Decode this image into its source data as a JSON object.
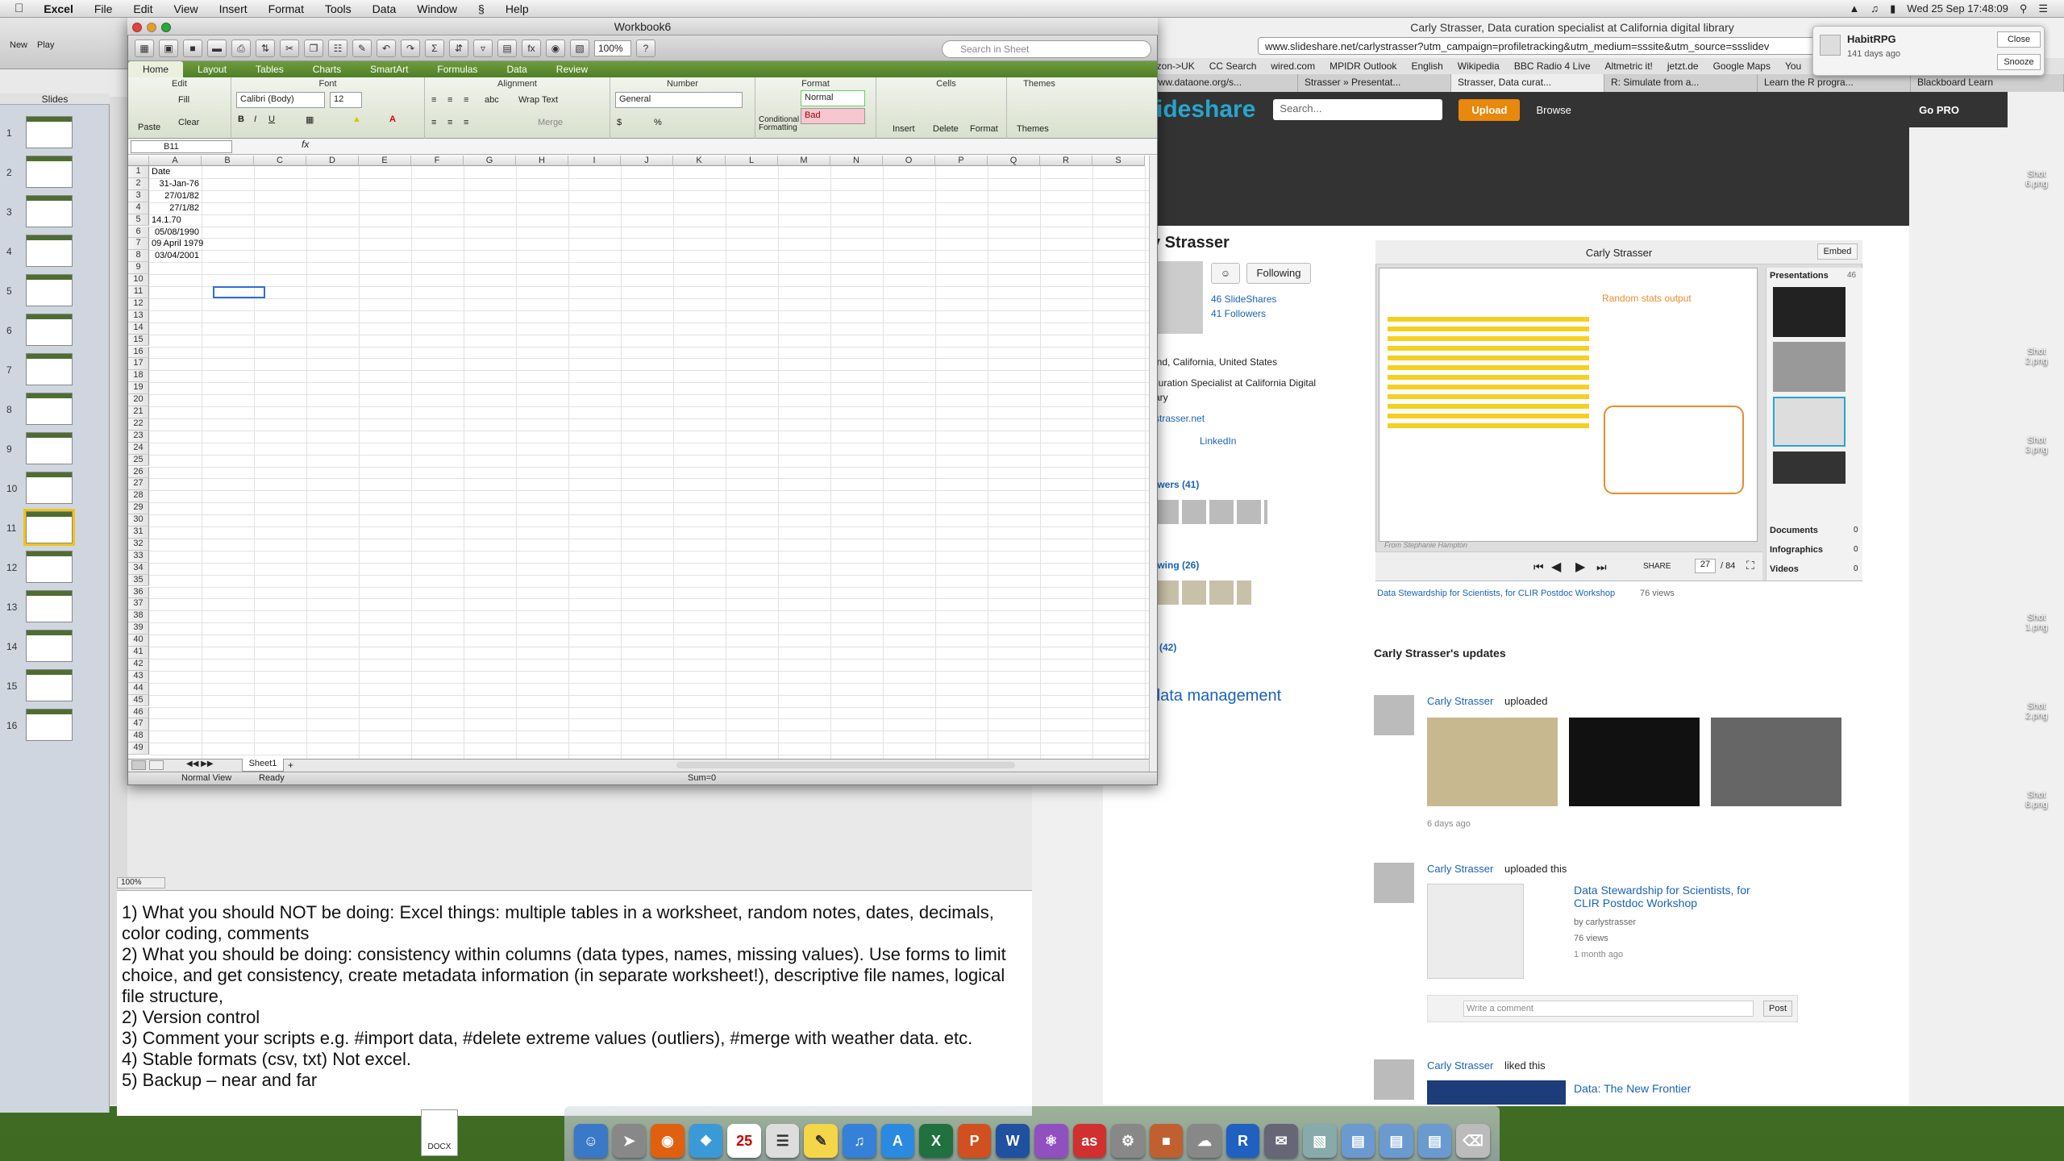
{
  "menubar": {
    "app": "Excel",
    "items": [
      "File",
      "Edit",
      "View",
      "Insert",
      "Format",
      "Tools",
      "Data",
      "Window",
      "Help"
    ],
    "datetime": "Wed 25 Sep  17:48:09"
  },
  "ppt": {
    "toolbar": {
      "new_label": "New",
      "play_label": "Play"
    },
    "slides_label": "Slides",
    "slide_numbers": [
      "1",
      "2",
      "3",
      "4",
      "5",
      "6",
      "7",
      "8",
      "9",
      "10",
      "11",
      "12",
      "13",
      "14",
      "15",
      "16"
    ],
    "zoom": "100%",
    "notes": [
      "1) What you should NOT be doing: Excel things: multiple tables in a worksheet, random notes, dates, decimals, color coding, comments",
      "2) What you should be doing: consistency within columns (data types, names, missing values). Use forms to limit choice, and get consistency, create metadata information (in separate worksheet!), descriptive file names, logical file structure,",
      "2) Version control",
      "3) Comment your scripts e.g. #import data, #delete extreme values (outliers), #merge with weather data. etc.",
      "4) Stable formats (csv, txt) Not excel.",
      "5) Backup – near and far"
    ],
    "dock_file": "DOCX"
  },
  "excel": {
    "title": "Workbook6",
    "zoom": "100%",
    "search_placeholder": "Search in Sheet",
    "ribbon_tabs": [
      "Home",
      "Layout",
      "Tables",
      "Charts",
      "SmartArt",
      "Formulas",
      "Data",
      "Review"
    ],
    "groups": {
      "edit": "Edit",
      "font": "Font",
      "alignment": "Alignment",
      "number": "Number",
      "format": "Format",
      "cells": "Cells",
      "themes": "Themes"
    },
    "buttons": {
      "paste": "Paste",
      "fill": "Fill",
      "clear": "Clear",
      "font_name": "Calibri (Body)",
      "font_size": "12",
      "wrap": "Wrap Text",
      "merge": "Merge",
      "number_format": "General",
      "cond_format": "Conditional Formatting",
      "style_normal": "Normal",
      "style_bad": "Bad",
      "insert": "Insert",
      "delete": "Delete",
      "format": "Format",
      "themes": "Themes"
    },
    "name_box": "B11",
    "columns": [
      "A",
      "B",
      "C",
      "D",
      "E",
      "F",
      "G",
      "H",
      "I",
      "J",
      "K",
      "L",
      "M",
      "N",
      "O",
      "P",
      "Q",
      "R",
      "S"
    ],
    "cells": [
      {
        "row": 1,
        "text": "Date",
        "align": "left"
      },
      {
        "row": 2,
        "text": "31-Jan-76",
        "align": "right"
      },
      {
        "row": 3,
        "text": "27/01/82",
        "align": "right"
      },
      {
        "row": 4,
        "text": "27/1/82",
        "align": "right"
      },
      {
        "row": 5,
        "text": "14.1.70",
        "align": "left"
      },
      {
        "row": 6,
        "text": "05/08/1990",
        "align": "right"
      },
      {
        "row": 7,
        "text": "09 April 1979",
        "align": "right"
      },
      {
        "row": 8,
        "text": "03/04/2001",
        "align": "right"
      }
    ],
    "sheet_tab": "Sheet1",
    "status": {
      "view": "Normal View",
      "state": "Ready",
      "sum": "Sum=0"
    }
  },
  "browser": {
    "title": "Carly Strasser, Data curation specialist at California digital library",
    "url": "www.slideshare.net/carlystrasser?utm_campaign=profiletracking&utm_medium=sssite&utm_source=ssslidev",
    "bookmarks": [
      "azon->UK",
      "CC Search",
      "wired.com",
      "MPIDR Outlook",
      "English",
      "Wikipedia",
      "BBC Radio 4 Live",
      "Altmetric it!",
      "jetzt.de",
      "Google Maps",
      "You"
    ],
    "tabs": [
      "www.dataone.org/s...",
      "Strasser » Presentat...",
      "Strasser, Data curat...",
      "R: Simulate from a...",
      "Learn the R progra...",
      "Blackboard Learn"
    ],
    "slideshare": {
      "logo": "ideshare",
      "search_placeholder": "Search...",
      "upload": "Upload",
      "browse": "Browse",
      "gopro": "Go PRO",
      "name": "y Strasser",
      "following": "Following",
      "slideshares": "46 SlideShares",
      "followers": "41 Followers",
      "location": "and, California, United States",
      "role": "Curation Specialist at California Digital",
      "role2": "rary",
      "site": "rstrasser.net",
      "linkedin": "LinkedIn",
      "followers_h": "owers (41)",
      "following_h": "owing (26)",
      "tags_h": "s (42)",
      "player_title": "Carly Strasser",
      "embed": "Embed",
      "slide_annotation": "Random stats output",
      "credit": "From Stephanie Hampton",
      "share": "SHARE",
      "page": "27",
      "of_pages": "/ 84",
      "presentations": "Presentations",
      "pres_count": "46",
      "documents": "Documents",
      "infographics": "Infographics",
      "videos": "Videos",
      "zero": "0",
      "deck_title": "Data Stewardship for Scientists, for CLIR Postdoc Workshop",
      "deck_views": "76 views",
      "updates_title": "Carly Strasser's updates",
      "update1_who": "Carly Strasser",
      "update1_action": "uploaded",
      "update1_time": "6 days ago",
      "update2_action": "uploaded this",
      "update2_title": "Data Stewardship for Scientists, for CLIR Postdoc Workshop",
      "update2_by": "by carlystrasser",
      "update2_views": "76 views",
      "update2_time": "1 month ago",
      "comment_placeholder": "Write a comment",
      "post": "Post",
      "update3_action": "liked this",
      "update3_title": "Data: The New Frontier",
      "tag_text": "data management"
    }
  },
  "notification": {
    "app": "HabitRPG",
    "time": "141 days ago",
    "close": "Close",
    "snooze": "Snooze"
  },
  "desktop_shots": [
    "Shot\n6.png",
    "Shot\n2.png",
    "Shot\n3.png",
    "Shot\n1.png",
    "Shot\n2.png",
    "Shot\n8.png"
  ]
}
